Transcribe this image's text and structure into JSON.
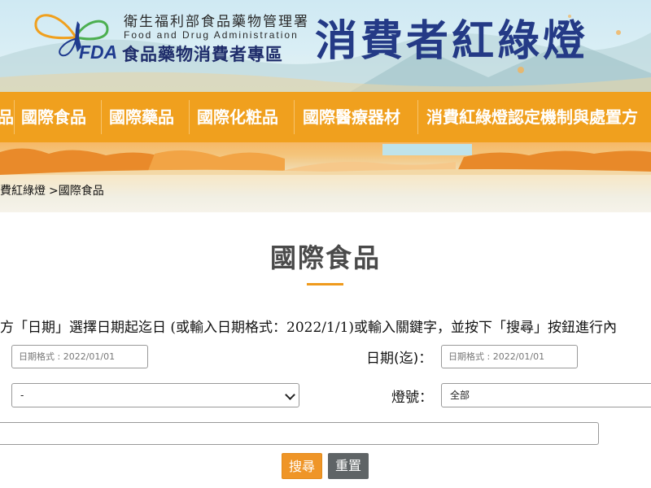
{
  "header": {
    "agency_name": "衛生福利部食品藥物管理署",
    "agency_english": "Food and Drug Administration",
    "fda_mark": "FDA",
    "zone_name": "食品藥物消費者專區",
    "site_title": "消費者紅綠燈"
  },
  "nav": {
    "items": [
      {
        "label": "品"
      },
      {
        "label": "國際食品"
      },
      {
        "label": "國際藥品"
      },
      {
        "label": "國際化粧品"
      },
      {
        "label": "國際醫療器材"
      },
      {
        "label": "消費紅綠燈認定機制與處置方"
      }
    ]
  },
  "breadcrumb": {
    "items": [
      "費紅綠燈",
      ">國際食品"
    ]
  },
  "main": {
    "page_title": "國際食品",
    "instruction": "方「日期」選擇日期起迄日 (或輸入日期格式：2022/1/1)或輸入關鍵字，並按下「搜尋」按鈕進行內",
    "start_date": {
      "label": "：",
      "placeholder": "日期格式 : 2022/01/01"
    },
    "end_date": {
      "label": "日期(迄)：",
      "placeholder": "日期格式 : 2022/01/01"
    },
    "category": {
      "label": "：",
      "selected": "-"
    },
    "light": {
      "label": "燈號：",
      "selected": "全部"
    },
    "keyword": {
      "value": ""
    },
    "search_button": "搜尋",
    "reset_button": "重置"
  },
  "colors": {
    "nav_bg": "#f0a01e",
    "title_blue": "#243a86",
    "accent_orange": "#ef9527",
    "reset_gray": "#5f6466"
  }
}
